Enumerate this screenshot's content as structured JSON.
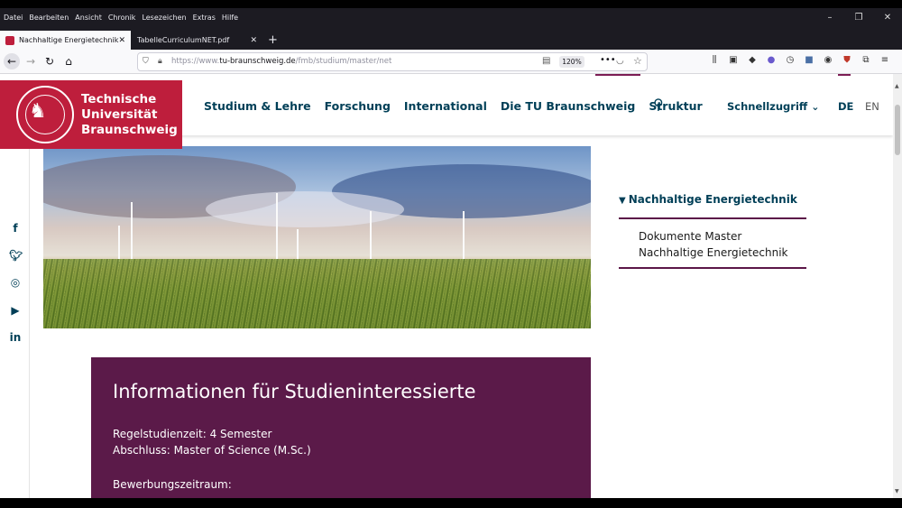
{
  "browser": {
    "menu": [
      "Datei",
      "Bearbeiten",
      "Ansicht",
      "Chronik",
      "Lesezeichen",
      "Extras",
      "Hilfe"
    ],
    "tabs": [
      {
        "title": "Nachhaltige Energietechnik",
        "active": true
      },
      {
        "title": "TabelleCurriculumNET.pdf",
        "active": false
      }
    ],
    "url_prefix": "https://www.",
    "url_domain": "tu-braunschweig.de",
    "url_path": "/fmb/studium/master/net",
    "zoom": "120%"
  },
  "site": {
    "logo_line1": "Technische",
    "logo_line2": "Universität",
    "logo_line3": "Braunschweig",
    "nav": [
      "Studium & Lehre",
      "Forschung",
      "International",
      "Die TU Braunschweig",
      "Struktur"
    ],
    "quick_access": "Schnellzugriff",
    "lang_de": "DE",
    "lang_en": "EN",
    "brand_color": "#be1e3c",
    "accent_color": "#5b1a49"
  },
  "sidebar": {
    "current": "Nachhaltige Energietechnik",
    "item": "Dokumente Master Nachhaltige Energietechnik"
  },
  "info": {
    "title": "Informationen für Studieninteressierte",
    "duration": "Regelstudienzeit: 4 Semester",
    "degree": "Abschluss: Master of Science (M.Sc.)",
    "application": "Bewerbungszeitraum:"
  }
}
